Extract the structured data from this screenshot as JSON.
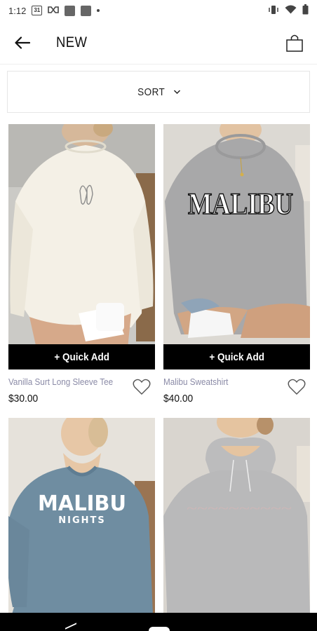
{
  "status_bar": {
    "time": "1:12",
    "calendar_day": "31"
  },
  "header": {
    "title": "NEW"
  },
  "sort": {
    "label": "SORT"
  },
  "products": [
    {
      "name": "Vanilla Surt Long Sleeve Tee",
      "price": "$30.00",
      "quick_add": "+ Quick Add",
      "image": {
        "bg": "#c9c9c7",
        "garment": "#f3efe4",
        "print": "surfboard-doodle",
        "print_color": "#888"
      }
    },
    {
      "name": "Malibu Sweatshirt",
      "price": "$40.00",
      "quick_add": "+ Quick Add",
      "image": {
        "bg": "#d7d4cf",
        "garment": "#a9a9aa",
        "print": "MALIBU",
        "print_color": "#ffffff"
      }
    },
    {
      "name": "",
      "price": "",
      "quick_add": "",
      "image": {
        "bg": "#e5e1da",
        "garment": "#6f8ca0",
        "print": "MALIBU",
        "subprint": "NIGHTS",
        "print_color": "#ffffff"
      }
    },
    {
      "name": "",
      "price": "",
      "quick_add": "",
      "image": {
        "bg": "#d9d6d1",
        "garment": "#b8b8b9",
        "print": "",
        "print_color": "#d9b6b6"
      }
    }
  ],
  "colors": {
    "accent": "#000000",
    "product_name": "#8a8aa6",
    "price": "#111111",
    "quick_add_bg": "#000000",
    "quick_add_text": "#ffffff"
  }
}
